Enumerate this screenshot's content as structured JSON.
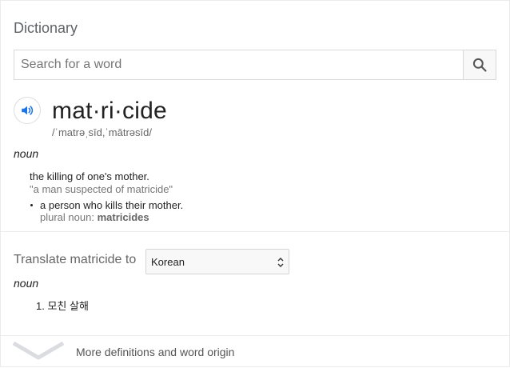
{
  "card": {
    "title": "Dictionary",
    "search": {
      "placeholder": "Search for a word",
      "value": ""
    },
    "icons": {
      "search": "search-icon",
      "speaker": "speaker-icon",
      "chevron": "chevron-down-icon"
    },
    "entry": {
      "word": "mat·ri·cide",
      "phonetic": "/ˈmatrəˌsīd,ˈmātrəsīd/",
      "part_of_speech": "noun",
      "definitions": [
        {
          "text": "the killing of one's mother.",
          "example": "\"a man suspected of matricide\""
        },
        {
          "text": "a person who kills their mother.",
          "plural_label": "plural noun:",
          "plural_value": "matricides"
        }
      ]
    },
    "translate": {
      "label": "Translate matricide to",
      "selected_language": "Korean",
      "part_of_speech": "noun",
      "results": [
        "1. 모친 살해"
      ]
    },
    "more_link": "More definitions and word origin"
  },
  "colors": {
    "accent_blue": "#4285f4",
    "text_primary": "#222222",
    "text_secondary": "#777777"
  }
}
